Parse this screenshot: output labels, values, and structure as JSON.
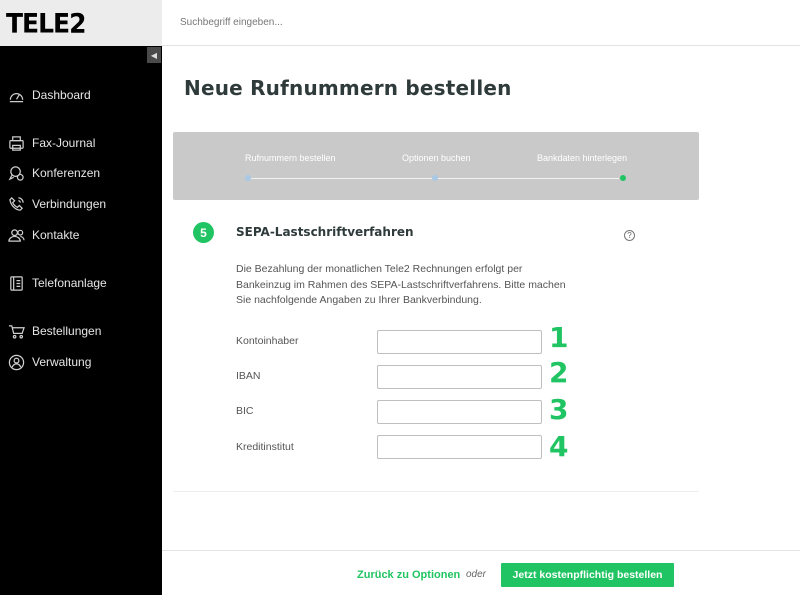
{
  "brand": {
    "logo_text": "TELE2",
    "accent_color": "#20c462"
  },
  "sidebar": {
    "collapse_glyph": "◀",
    "items": [
      {
        "label": "Dashboard",
        "icon": "speedometer-icon"
      },
      {
        "label": "Fax-Journal",
        "icon": "fax-icon"
      },
      {
        "label": "Konferenzen",
        "icon": "conference-icon"
      },
      {
        "label": "Verbindungen",
        "icon": "phone-call-icon"
      },
      {
        "label": "Kontakte",
        "icon": "contacts-icon"
      },
      {
        "label": "Telefonanlage",
        "icon": "phone-system-icon"
      },
      {
        "label": "Bestellungen",
        "icon": "cart-icon"
      },
      {
        "label": "Verwaltung",
        "icon": "user-circle-icon"
      }
    ]
  },
  "search": {
    "placeholder": "Suchbegriff eingeben..."
  },
  "page": {
    "title": "Neue Rufnummern bestellen"
  },
  "stepper": {
    "steps": [
      {
        "label": "Rufnummern bestellen",
        "state": "done"
      },
      {
        "label": "Optionen buchen",
        "state": "done"
      },
      {
        "label": "Bankdaten hinterlegen",
        "state": "active"
      }
    ]
  },
  "section": {
    "number": "5",
    "title": "SEPA-Lastschriftverfahren",
    "help_glyph": "?",
    "description": "Die Bezahlung der monatlichen Tele2 Rechnungen erfolgt per Bankeinzug im Rahmen des SEPA-Lastschriftverfahrens. Bitte machen Sie nachfolgende Angaben zu Ihrer Bankverbindung.",
    "fields": [
      {
        "label": "Kontoinhaber",
        "value": "",
        "annotation": "1"
      },
      {
        "label": "IBAN",
        "value": "",
        "annotation": "2"
      },
      {
        "label": "BIC",
        "value": "",
        "annotation": "3"
      },
      {
        "label": "Kreditinstitut",
        "value": "",
        "annotation": "4"
      }
    ]
  },
  "footer": {
    "back_label": "Zurück zu Optionen",
    "or_label": "oder",
    "submit_label": "Jetzt kostenpflichtig bestellen"
  }
}
